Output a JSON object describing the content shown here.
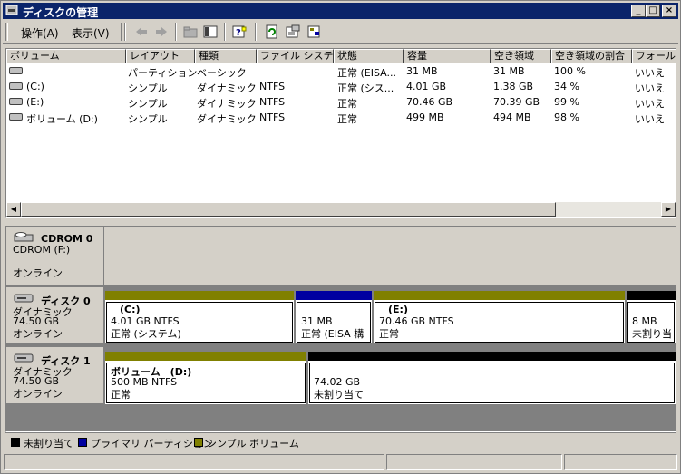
{
  "window": {
    "title": "ディスクの管理"
  },
  "menu": {
    "action": "操作(A)",
    "view": "表示(V)"
  },
  "toolbar": {
    "icons": [
      "back-arrow-icon",
      "forward-arrow-icon",
      "folder-up-icon",
      "show-hide-tree-icon",
      "help-icon",
      "refresh-icon",
      "properties-icon",
      "export-icon"
    ]
  },
  "list": {
    "headers": [
      "ボリューム",
      "レイアウト",
      "種類",
      "ファイル システム",
      "状態",
      "容量",
      "空き領域",
      "空き領域の割合",
      "フォールト"
    ],
    "rows": [
      [
        "",
        "パーティション",
        "ベーシック",
        "",
        "正常 (EISA...",
        "31 MB",
        "31 MB",
        "100 %",
        "いいえ"
      ],
      [
        "(C:)",
        "シンプル",
        "ダイナミック",
        "NTFS",
        "正常 (シス...",
        "4.01 GB",
        "1.38 GB",
        "34 %",
        "いいえ"
      ],
      [
        "(E:)",
        "シンプル",
        "ダイナミック",
        "NTFS",
        "正常",
        "70.46 GB",
        "70.39 GB",
        "99 %",
        "いいえ"
      ],
      [
        "ボリューム (D:)",
        "シンプル",
        "ダイナミック",
        "NTFS",
        "正常",
        "499 MB",
        "494 MB",
        "98 %",
        "いいえ"
      ]
    ]
  },
  "disks": {
    "cdrom": {
      "name": "CDROM 0",
      "sub": "CDROM (F:)",
      "status": "オンライン"
    },
    "disk0": {
      "name": "ディスク 0",
      "type": "ダイナミック",
      "size": "74.50 GB",
      "status": "オンライン",
      "parts": [
        {
          "title": "(C:)",
          "line1": "4.01 GB NTFS",
          "line2": "正常 (システム)"
        },
        {
          "title": "",
          "line1": "31 MB",
          "line2": "正常 (EISA 構"
        },
        {
          "title": "(E:)",
          "line1": "70.46 GB NTFS",
          "line2": "正常"
        },
        {
          "title": "",
          "line1": "8 MB",
          "line2": "未割り当"
        }
      ]
    },
    "disk1": {
      "name": "ディスク 1",
      "type": "ダイナミック",
      "size": "74.50 GB",
      "status": "オンライン",
      "parts": [
        {
          "title": "ボリューム　(D:)",
          "line1": "500 MB NTFS",
          "line2": "正常"
        },
        {
          "title": "",
          "line1": "74.02 GB",
          "line2": "未割り当て"
        }
      ]
    }
  },
  "legend": {
    "unallocated": "未割り当て",
    "primary": "プライマリ パーティション",
    "simple": "シンプル ボリューム"
  },
  "colors": {
    "titlebar": "#0a246a",
    "simple": "#808000",
    "primary": "#0000a0",
    "unallocated": "#000000"
  }
}
